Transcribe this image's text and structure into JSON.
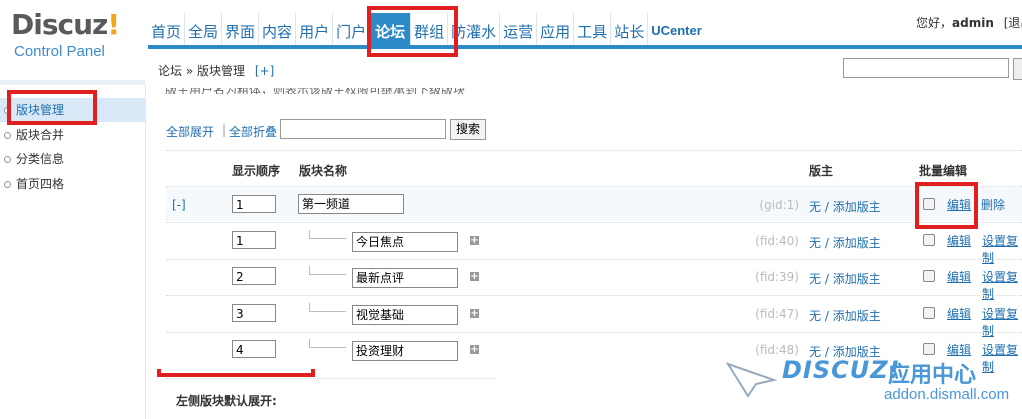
{
  "logo": {
    "brand_main": "Discuz",
    "brand_mark": "!",
    "subtitle": "Control Panel"
  },
  "topnav": [
    {
      "label": "首页"
    },
    {
      "label": "全局"
    },
    {
      "label": "界面"
    },
    {
      "label": "内容"
    },
    {
      "label": "用户"
    },
    {
      "label": "门户"
    },
    {
      "label": "论坛",
      "active": true
    },
    {
      "label": "群组"
    },
    {
      "label": "防灌水"
    },
    {
      "label": "运营"
    },
    {
      "label": "应用"
    },
    {
      "label": "工具"
    },
    {
      "label": "站长"
    },
    {
      "label": "UCenter"
    }
  ],
  "user": {
    "greeting": "您好，",
    "name": "admin",
    "logout": "[退出"
  },
  "breadcrumb": {
    "section": "论坛",
    "sep": "»",
    "page": "版块管理",
    "add": "[+]"
  },
  "sidebar": [
    {
      "label": "版块管理",
      "active": true
    },
    {
      "label": "版块合并"
    },
    {
      "label": "分类信息"
    },
    {
      "label": "首页四格"
    }
  ],
  "tip": "版主用户名为粗体，则表示该版主权限可继承到下级版块",
  "controls": {
    "expand_all": "全部展开",
    "sep": "|",
    "collapse_all": "全部折叠",
    "search_value": "",
    "search_button": "搜索"
  },
  "table": {
    "headers": {
      "order": "显示顺序",
      "name": "版块名称",
      "moderator": "版主",
      "batch": "批量编辑"
    },
    "group": {
      "toggle": "[-]",
      "order": "1",
      "name": "第一频道",
      "id": "(gid:1)",
      "mod_none": "无",
      "mod_sep": " / ",
      "mod_add": "添加版主",
      "edit": "编辑",
      "delete": "删除"
    },
    "forums": [
      {
        "order": "1",
        "name": "今日焦点",
        "id": "(fid:40)",
        "mod_none": "无",
        "mod_sep": " / ",
        "mod_add": "添加版主",
        "edit": "编辑",
        "copy": "设置复制"
      },
      {
        "order": "2",
        "name": "最新点评",
        "id": "(fid:39)",
        "mod_none": "无",
        "mod_sep": " / ",
        "mod_add": "添加版主",
        "edit": "编辑",
        "copy": "设置复制"
      },
      {
        "order": "3",
        "name": "视觉基础",
        "id": "(fid:47)",
        "mod_none": "无",
        "mod_sep": " / ",
        "mod_add": "添加版主",
        "edit": "编辑",
        "copy": "设置复制"
      },
      {
        "order": "4",
        "name": "投资理财",
        "id": "(fid:48)",
        "mod_none": "无",
        "mod_sep": " / ",
        "mod_add": "添加版主",
        "edit": "编辑",
        "copy": "设置复制"
      }
    ]
  },
  "left_label": "左侧版块默认展开:",
  "watermark": {
    "brand": "DISCUZ!",
    "cn": "应用中心",
    "url": "addon.dismall.com"
  },
  "colors": {
    "nav_blue": "#2c8ac9",
    "link_blue": "#1f6fb0",
    "highlight_red": "#e02020",
    "logo_orange": "#f3a41c"
  }
}
